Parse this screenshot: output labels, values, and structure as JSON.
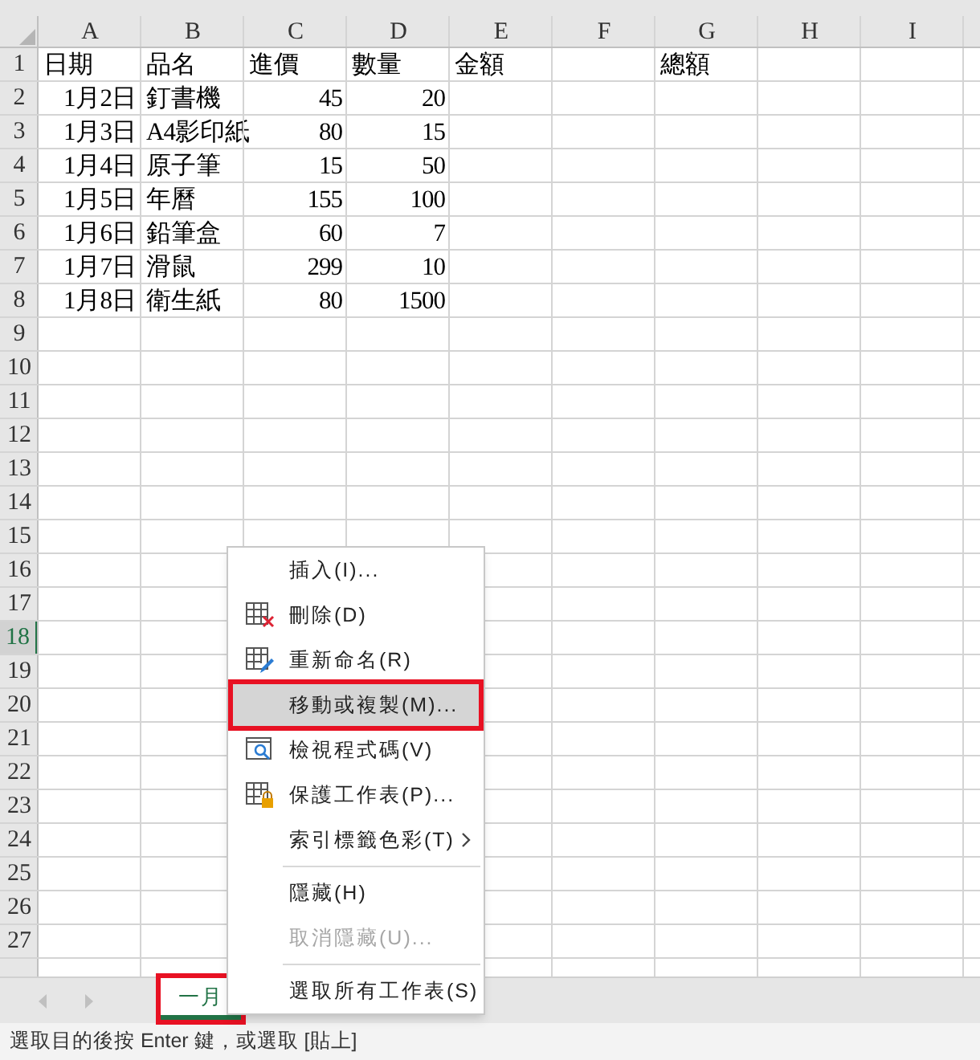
{
  "columns": [
    "A",
    "B",
    "C",
    "D",
    "E",
    "F",
    "G",
    "H",
    "I"
  ],
  "rows": [
    {
      "header": "1",
      "selected": false,
      "cells": [
        {
          "text": "日期",
          "kind": "text"
        },
        {
          "text": "品名",
          "kind": "text"
        },
        {
          "text": "進價",
          "kind": "text"
        },
        {
          "text": "數量",
          "kind": "text"
        },
        {
          "text": "金額",
          "kind": "text"
        },
        {
          "kind": "empty"
        },
        {
          "text": "總額",
          "kind": "text"
        }
      ]
    },
    {
      "header": "2",
      "selected": false,
      "cells": [
        {
          "text": "1月2日",
          "kind": "number"
        },
        {
          "text": "釘書機",
          "kind": "text"
        },
        {
          "text": "45",
          "kind": "number"
        },
        {
          "text": "20",
          "kind": "number"
        }
      ]
    },
    {
      "header": "3",
      "selected": false,
      "cells": [
        {
          "text": "1月3日",
          "kind": "number"
        },
        {
          "text": "A4影印紙",
          "kind": "text"
        },
        {
          "text": "80",
          "kind": "number"
        },
        {
          "text": "15",
          "kind": "number"
        }
      ]
    },
    {
      "header": "4",
      "selected": false,
      "cells": [
        {
          "text": "1月4日",
          "kind": "number"
        },
        {
          "text": "原子筆",
          "kind": "text"
        },
        {
          "text": "15",
          "kind": "number"
        },
        {
          "text": "50",
          "kind": "number"
        }
      ]
    },
    {
      "header": "5",
      "selected": false,
      "cells": [
        {
          "text": "1月5日",
          "kind": "number"
        },
        {
          "text": "年曆",
          "kind": "text"
        },
        {
          "text": "155",
          "kind": "number"
        },
        {
          "text": "100",
          "kind": "number"
        }
      ]
    },
    {
      "header": "6",
      "selected": false,
      "cells": [
        {
          "text": "1月6日",
          "kind": "number"
        },
        {
          "text": "鉛筆盒",
          "kind": "text"
        },
        {
          "text": "60",
          "kind": "number"
        },
        {
          "text": "7",
          "kind": "number"
        }
      ]
    },
    {
      "header": "7",
      "selected": false,
      "cells": [
        {
          "text": "1月7日",
          "kind": "number"
        },
        {
          "text": "滑鼠",
          "kind": "text"
        },
        {
          "text": "299",
          "kind": "number"
        },
        {
          "text": "10",
          "kind": "number"
        }
      ]
    },
    {
      "header": "8",
      "selected": false,
      "cells": [
        {
          "text": "1月8日",
          "kind": "number"
        },
        {
          "text": "衛生紙",
          "kind": "text"
        },
        {
          "text": "80",
          "kind": "number"
        },
        {
          "text": "1500",
          "kind": "number"
        }
      ]
    },
    {
      "header": "9",
      "selected": false
    },
    {
      "header": "10",
      "selected": false
    },
    {
      "header": "11",
      "selected": false
    },
    {
      "header": "12",
      "selected": false
    },
    {
      "header": "13",
      "selected": false
    },
    {
      "header": "14",
      "selected": false
    },
    {
      "header": "15",
      "selected": false
    },
    {
      "header": "16",
      "selected": false
    },
    {
      "header": "17",
      "selected": false
    },
    {
      "header": "18",
      "selected": true
    },
    {
      "header": "19",
      "selected": false
    },
    {
      "header": "20",
      "selected": false
    },
    {
      "header": "21",
      "selected": false
    },
    {
      "header": "22",
      "selected": false
    },
    {
      "header": "23",
      "selected": false
    },
    {
      "header": "24",
      "selected": false
    },
    {
      "header": "25",
      "selected": false
    },
    {
      "header": "26",
      "selected": false
    },
    {
      "header": "27",
      "selected": false
    }
  ],
  "context_menu": [
    {
      "kind": "item",
      "label": "插入(I)...",
      "selected": false,
      "highlighted": false,
      "disabled": false,
      "submenu": false
    },
    {
      "kind": "item",
      "label": "刪除(D)",
      "selected": false,
      "highlighted": false,
      "disabled": false,
      "submenu": false
    },
    {
      "kind": "item",
      "label": "重新命名(R)",
      "selected": false,
      "highlighted": false,
      "disabled": false,
      "submenu": false
    },
    {
      "kind": "item",
      "label": "移動或複製(M)...",
      "selected": true,
      "highlighted": true,
      "disabled": false,
      "submenu": false
    },
    {
      "kind": "item",
      "label": "檢視程式碼(V)",
      "selected": false,
      "highlighted": false,
      "disabled": false,
      "submenu": false
    },
    {
      "kind": "item",
      "label": "保護工作表(P)...",
      "selected": false,
      "highlighted": false,
      "disabled": false,
      "submenu": false
    },
    {
      "kind": "item",
      "label": "索引標籤色彩(T)",
      "selected": false,
      "highlighted": false,
      "disabled": false,
      "submenu": true
    },
    {
      "kind": "separator"
    },
    {
      "kind": "item",
      "label": "隱藏(H)",
      "selected": false,
      "highlighted": false,
      "disabled": false,
      "submenu": false
    },
    {
      "kind": "item",
      "label": "取消隱藏(U)...",
      "selected": false,
      "highlighted": false,
      "disabled": true,
      "submenu": false
    },
    {
      "kind": "separator"
    },
    {
      "kind": "item",
      "label": "選取所有工作表(S)",
      "selected": false,
      "highlighted": false,
      "disabled": false,
      "submenu": false
    }
  ],
  "sheet_tabs": [
    {
      "label": "一月",
      "selected": true,
      "highlighted": true
    }
  ],
  "status_bar": "選取目的後按 Enter 鍵，或選取 [貼上]"
}
